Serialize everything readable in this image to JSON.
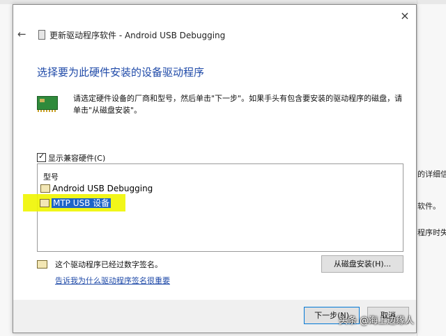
{
  "background": {
    "text_1": "的详细信息",
    "text_2": "软件。",
    "text_3": "程序时失败"
  },
  "dialog": {
    "close_icon": "×",
    "back_icon": "←",
    "title": "更新驱动程序软件 - Android USB Debugging",
    "heading": "选择要为此硬件安装的设备驱动程序",
    "description": "请选定硬件设备的厂商和型号，然后单击\"下一步\"。如果手头有包含要安装的驱动程序的磁盘，请单击\"从磁盘安装\"。",
    "compat_label": "显示兼容硬件(C)",
    "list": {
      "header": "型号",
      "items": [
        {
          "label": "Android USB Debugging"
        },
        {
          "label": "MTP USB 设备"
        }
      ]
    },
    "signature_text": "这个驱动程序已经过数字签名。",
    "signature_link": "告诉我为什么驱动程序签名很重要",
    "disk_button": "从磁盘安装(H)...",
    "next_button": "下一步(N)",
    "cancel_button": "取消"
  },
  "watermark": "头条 @海上边缘人",
  "colors": {
    "heading": "#1f4aa8",
    "highlight": "#f0f500",
    "selected": "#1e64c8"
  }
}
